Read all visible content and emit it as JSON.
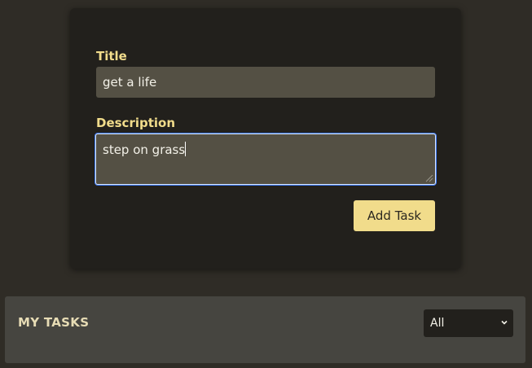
{
  "form": {
    "title_label": "Title",
    "title_value": "get a life",
    "description_label": "Description",
    "description_value": "step on grass",
    "add_button_label": "Add Task"
  },
  "tasks": {
    "heading": "MY TASKS",
    "filter_selected": "All"
  },
  "colors": {
    "accent": "#f1dc8b",
    "focus_border": "#3d79f5",
    "page_background": "#2f2c26",
    "card_background": "#22201c",
    "input_background": "#545044"
  },
  "icons": {
    "resize_grip": "resize-grip-icon",
    "filter_dropdown": "chevron-down-icon"
  }
}
